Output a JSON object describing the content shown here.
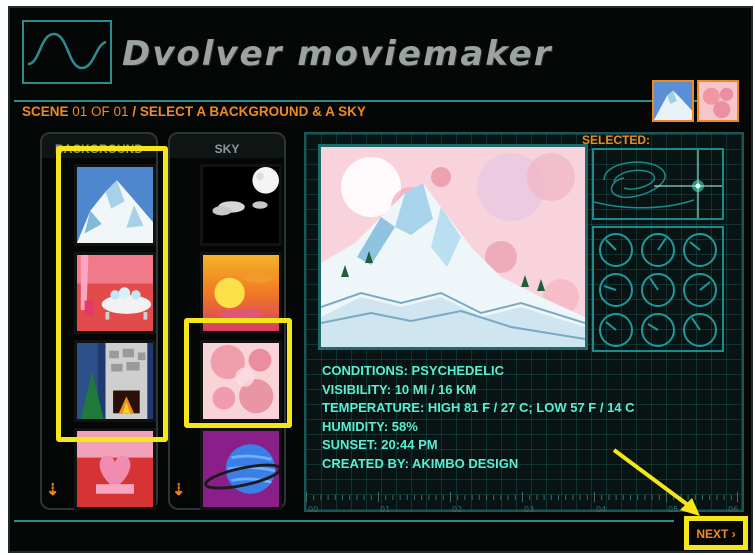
{
  "app": {
    "title": "Dvolver moviemaker"
  },
  "scene_bar": {
    "prefix": "SCENE",
    "scene_counter": "01 OF 01",
    "separator": "/",
    "instruction": "SELECT A BACKGROUND & A SKY"
  },
  "columns": {
    "background_label": "BACKGROUND",
    "sky_label": "SKY",
    "backgrounds": [
      {
        "id": "mountain",
        "icon": "mountain-background"
      },
      {
        "id": "bathroom",
        "icon": "bathtub-background"
      },
      {
        "id": "fireplace",
        "icon": "fireplace-background"
      },
      {
        "id": "bedroom",
        "icon": "heart-bed-background"
      }
    ],
    "skies": [
      {
        "id": "night",
        "icon": "moon-night-sky"
      },
      {
        "id": "sunset",
        "icon": "sunset-sky"
      },
      {
        "id": "psychedelic",
        "icon": "psychedelic-bubbles-sky"
      },
      {
        "id": "planet",
        "icon": "ringed-planet-sky"
      }
    ]
  },
  "preview": {
    "selected_label": "SELECTED:",
    "info": {
      "conditions": "CONDITIONS:  PSYCHEDELIC",
      "visibility": "VISIBILITY:  10 MI / 16 KM",
      "temperature": "TEMPERATURE:  HIGH 81 F / 27 C; LOW  57 F / 14 C",
      "humidity": "HUMIDITY:  58%",
      "sunset": "SUNSET:  20:44 PM",
      "created_by": "CREATED BY:  AKIMBO DESIGN"
    }
  },
  "timeline": {
    "labels": [
      "00",
      "01",
      "02",
      "03",
      "04",
      "05",
      "06"
    ]
  },
  "navigation": {
    "next_label": "NEXT",
    "next_glyph": "›"
  },
  "colors": {
    "accent_orange": "#f08a1e",
    "info_cyan": "#58f0d2",
    "grid_teal": "#2f8d8d",
    "highlight_yellow": "#f4e61a"
  }
}
